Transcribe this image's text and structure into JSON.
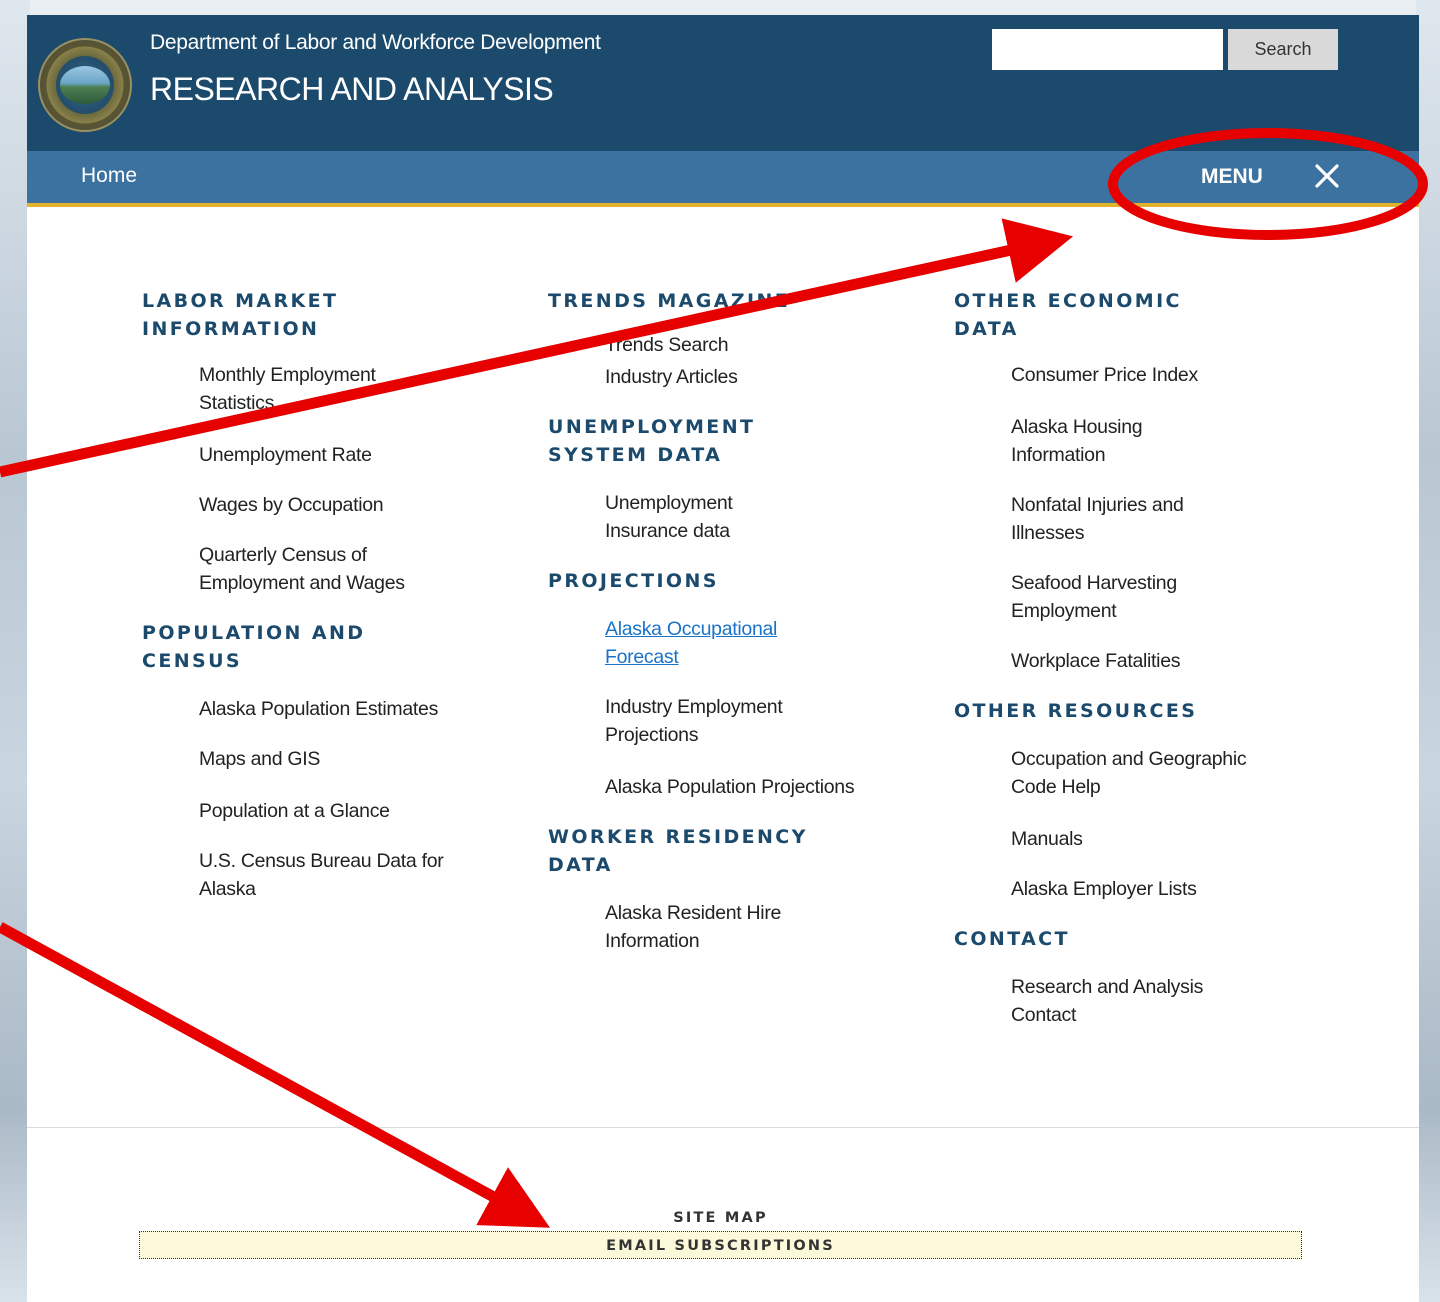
{
  "header": {
    "department": "Department of Labor and Workforce Development",
    "site_title": "RESEARCH AND ANALYSIS",
    "search": {
      "value": "",
      "button_label": "Search"
    }
  },
  "navbar": {
    "home_label": "Home",
    "menu_label": "MENU"
  },
  "menu": {
    "columns": [
      {
        "sections": [
          {
            "title": "LABOR MARKET INFORMATION",
            "items": [
              "Monthly Employment Statistics",
              "Unemployment Rate",
              "Wages by Occupation",
              "Quarterly Census of Employment and Wages"
            ]
          },
          {
            "title": "POPULATION AND CENSUS",
            "items": [
              "Alaska Population Estimates",
              "Maps and GIS",
              "Population at a Glance",
              "U.S. Census Bureau Data for Alaska"
            ]
          }
        ]
      },
      {
        "sections": [
          {
            "title": "TRENDS MAGAZINE",
            "items": [
              "Trends Search",
              "Industry Articles"
            ]
          },
          {
            "title": "UNEMPLOYMENT SYSTEM DATA",
            "items": [
              "Unemployment Insurance data"
            ]
          },
          {
            "title": "PROJECTIONS",
            "items": [
              "Alaska Occupational Forecast",
              "Industry Employment Projections",
              "Alaska Population Projections"
            ]
          },
          {
            "title": "WORKER RESIDENCY DATA",
            "items": [
              "Alaska Resident Hire Information"
            ]
          }
        ]
      },
      {
        "sections": [
          {
            "title": "OTHER ECONOMIC DATA",
            "items": [
              "Consumer Price Index",
              "Alaska Housing Information",
              "Nonfatal Injuries and Illnesses",
              "Seafood Harvesting Employment",
              "Workplace Fatalities"
            ]
          },
          {
            "title": "OTHER RESOURCES",
            "items": [
              "Occupation and Geographic Code Help",
              "Manuals",
              "Alaska Employer Lists"
            ]
          },
          {
            "title": "CONTACT",
            "items": [
              "Research and Analysis Contact"
            ]
          }
        ]
      }
    ]
  },
  "footer": {
    "site_map": "SITE MAP",
    "email_subscriptions": "EMAIL SUBSCRIPTIONS"
  },
  "colors": {
    "header_bg": "#1b4a6d",
    "navbar_bg": "#3c72a0",
    "accent_underline": "#e0b32a",
    "link_active": "#1a73c8",
    "annotation_red": "#e60000"
  },
  "icons": {
    "seal": "state-seal-icon",
    "close": "close-icon"
  }
}
